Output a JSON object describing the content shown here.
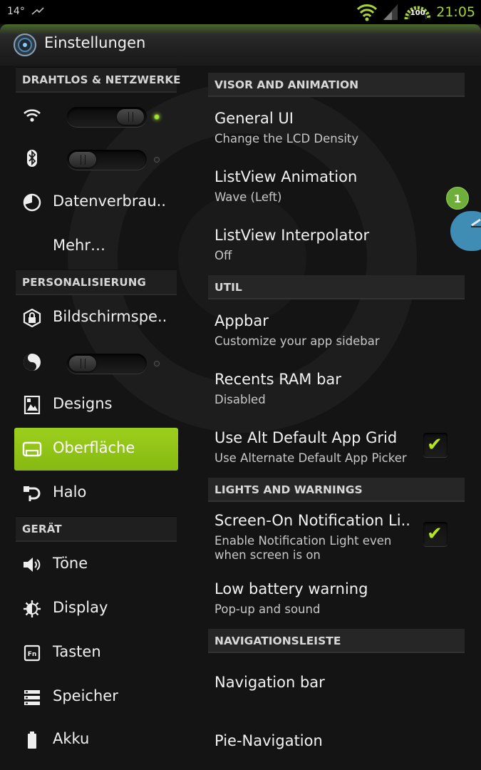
{
  "status_bar": {
    "temperature": "14°",
    "time": "21:05",
    "battery": "100",
    "accent_color": "#a6d236"
  },
  "action_bar": {
    "title": "Einstellungen",
    "icon": "settings-app-icon"
  },
  "sidebar": {
    "sections": [
      {
        "header": "DRAHTLOS & NETZWERKE"
      },
      {
        "header": "PERSONALISIERUNG"
      },
      {
        "header": "GERÄT"
      }
    ],
    "items": [
      {
        "icon": "wifi-icon",
        "label": "",
        "toggle": "on"
      },
      {
        "icon": "bluetooth-icon",
        "label": "",
        "toggle": "off"
      },
      {
        "icon": "data-usage-icon",
        "label": "Datenverbrau.."
      },
      {
        "icon": "",
        "label": "Mehr…"
      },
      {
        "icon": "lock-screen-icon",
        "label": "Bildschirmspe.."
      },
      {
        "icon": "yin-yang-icon",
        "label": "",
        "toggle": "off"
      },
      {
        "icon": "themes-icon",
        "label": "Designs"
      },
      {
        "icon": "interface-icon",
        "label": "Oberfläche",
        "active": true
      },
      {
        "icon": "halo-icon",
        "label": "Halo"
      },
      {
        "icon": "sound-icon",
        "label": "Töne"
      },
      {
        "icon": "display-icon",
        "label": "Display"
      },
      {
        "icon": "keys-icon",
        "label": "Tasten"
      },
      {
        "icon": "storage-icon",
        "label": "Speicher"
      },
      {
        "icon": "battery-icon",
        "label": "Akku"
      }
    ],
    "active_color": "#94c619"
  },
  "content": {
    "sections": [
      {
        "header": "VISOR AND ANIMATION"
      },
      {
        "header": "UTIL"
      },
      {
        "header": "LIGHTS AND WARNINGS"
      },
      {
        "header": "NAVIGATIONSLEISTE"
      }
    ],
    "prefs": [
      {
        "title": "General UI",
        "summary": "Change the LCD Density"
      },
      {
        "title": "ListView Animation",
        "summary": "Wave (Left)"
      },
      {
        "title": "ListView Interpolator",
        "summary": "Off"
      },
      {
        "title": "Appbar",
        "summary": "Customize your app sidebar"
      },
      {
        "title": "Recents RAM bar",
        "summary": "Disabled"
      },
      {
        "title": "Use Alt Default App Grid",
        "summary": "Use Alternate Default App Picker",
        "checked": true
      },
      {
        "title": "Screen-On Notification Li..",
        "summary": "Enable Notification Light even when screen is on",
        "checked": true
      },
      {
        "title": "Low battery warning",
        "summary": "Pop-up and sound"
      },
      {
        "title": "Navigation bar",
        "summary": ""
      },
      {
        "title": "Pie-Navigation",
        "summary": ""
      }
    ],
    "checkmark": "✔"
  },
  "halo_bubble": {
    "badge_count": "1",
    "color": "#3f8db5"
  }
}
